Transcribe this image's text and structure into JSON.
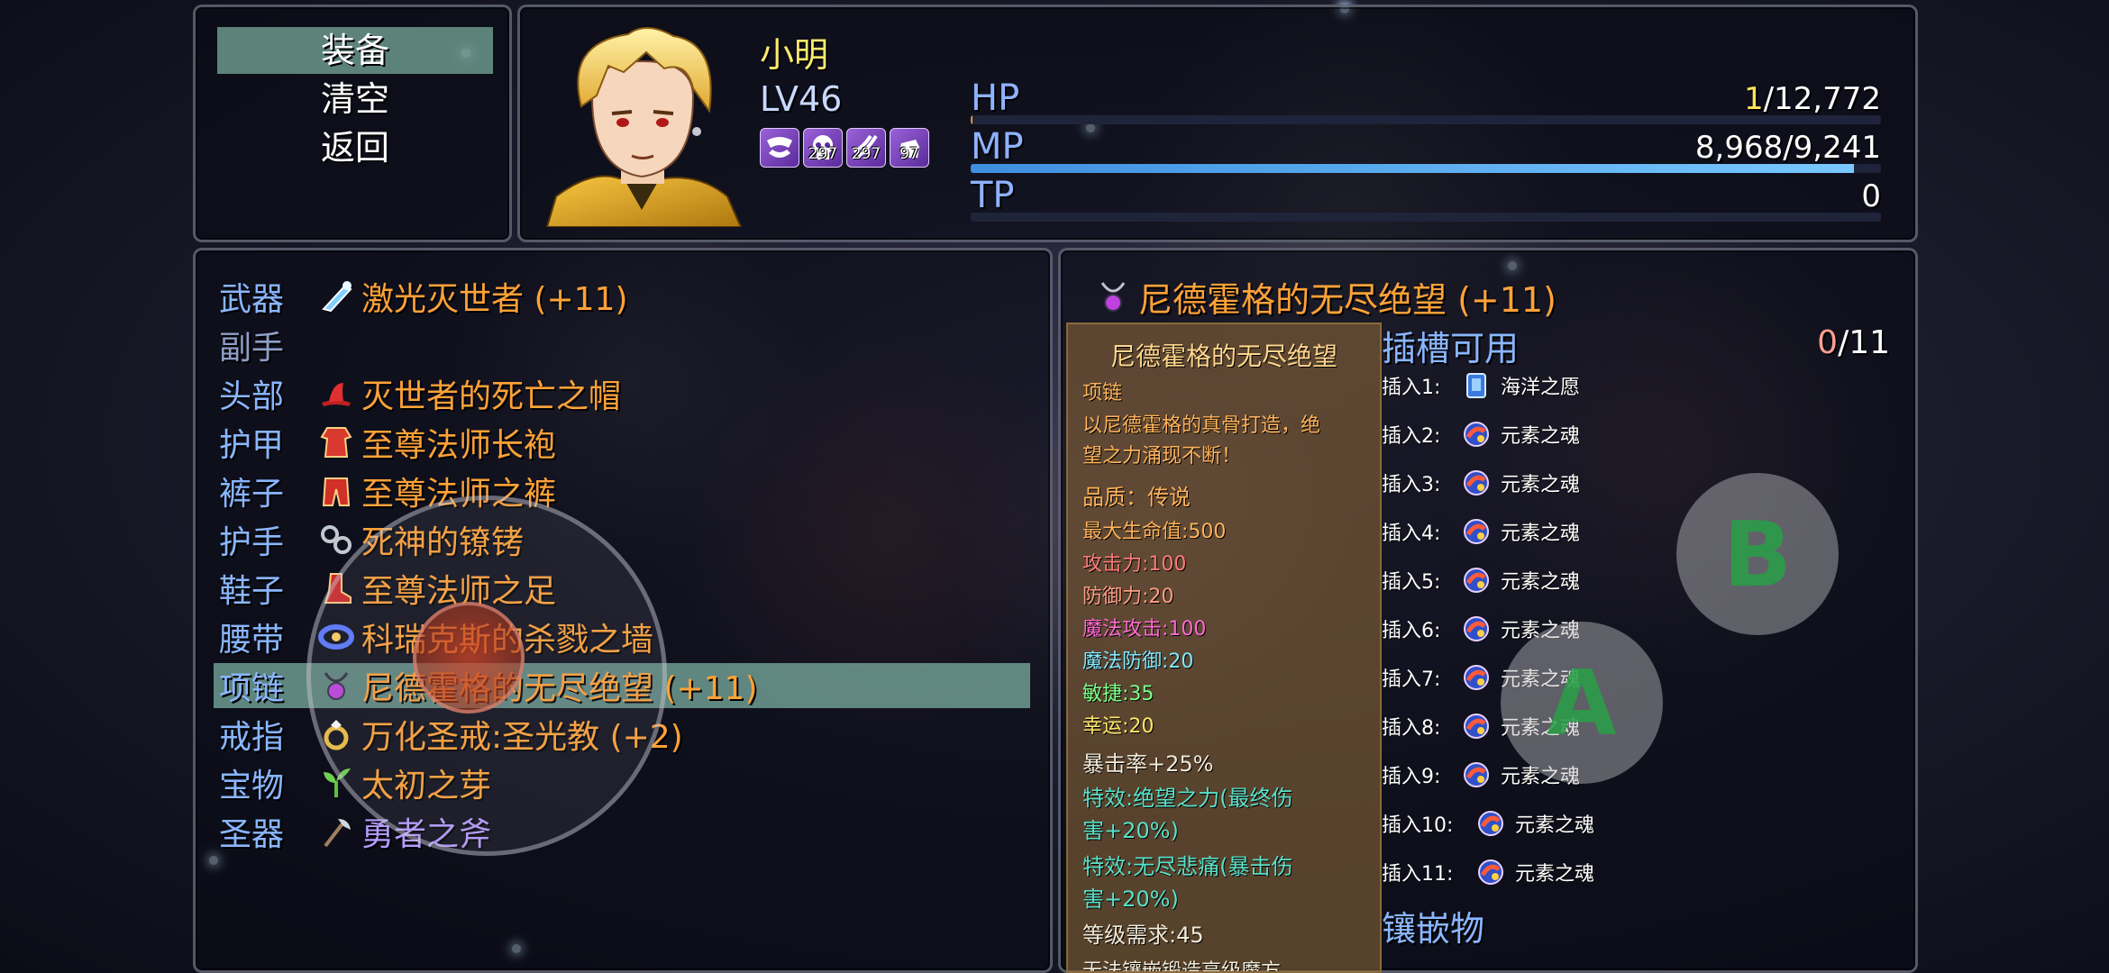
{
  "commands": {
    "equip": "装备",
    "clear": "清空",
    "back": "返回"
  },
  "actor": {
    "name": "小明",
    "level": "LV46",
    "states": [
      {
        "icon": "jaws-icon",
        "turns": ""
      },
      {
        "icon": "skull-icon",
        "turns": "297"
      },
      {
        "icon": "slash-icon",
        "turns": "297"
      },
      {
        "icon": "fist-icon",
        "turns": "97"
      }
    ],
    "hp": {
      "label": "HP",
      "current": "1",
      "max": "/12,772",
      "ratio": 0.0001
    },
    "mp": {
      "label": "MP",
      "value": "8,968/9,241",
      "ratio": 0.97
    },
    "tp": {
      "label": "TP",
      "value": "0",
      "ratio": 0
    }
  },
  "equip_slots": [
    {
      "slot": "武器",
      "item": "激光灭世者 (+11)",
      "icon": "laser-gun-icon"
    },
    {
      "slot": "副手",
      "item": "",
      "icon": ""
    },
    {
      "slot": "头部",
      "item": "灭世者的死亡之帽",
      "icon": "red-hat-icon"
    },
    {
      "slot": "护甲",
      "item": "至尊法师长袍",
      "icon": "robe-icon"
    },
    {
      "slot": "裤子",
      "item": "至尊法师之裤",
      "icon": "pants-icon"
    },
    {
      "slot": "护手",
      "item": "死神的镣铐",
      "icon": "shackles-icon"
    },
    {
      "slot": "鞋子",
      "item": "至尊法师之足",
      "icon": "boots-icon"
    },
    {
      "slot": "腰带",
      "item": "科瑞克斯的杀戮之墙",
      "icon": "belt-icon"
    },
    {
      "slot": "项链",
      "item": "尼德霍格的无尽绝望 (+11)",
      "icon": "necklace-icon"
    },
    {
      "slot": "戒指",
      "item": "万化圣戒:圣光教 (+2)",
      "icon": "ring-icon"
    },
    {
      "slot": "宝物",
      "item": "太初之芽",
      "icon": "sprout-icon"
    },
    {
      "slot": "圣器",
      "item": "勇者之斧",
      "icon": "axe-icon"
    }
  ],
  "detail": {
    "title": "尼德霍格的无尽绝望 (+11)",
    "desc_title": "尼德霍格的无尽绝望",
    "type": "项链",
    "flavor": [
      "以尼德霍格的真骨打造，绝",
      "望之力涌现不断！"
    ],
    "quality": "品质：传说",
    "stats": [
      {
        "text": "最大生命值:500",
        "color": "#ffb35a"
      },
      {
        "text": "攻击力:100",
        "color": "#ff7c7c"
      },
      {
        "text": "防御力:20",
        "color": "#ff9e86"
      },
      {
        "text": "魔法攻击:100",
        "color": "#ff6ad0"
      },
      {
        "text": "魔法防御:20",
        "color": "#82e8ff"
      },
      {
        "text": "敏捷:35",
        "color": "#7cff88"
      },
      {
        "text": "幸运:20",
        "color": "#ffe86a"
      }
    ],
    "crit": "暴击率+25%",
    "effects": [
      [
        "特效:绝望之力(最终伤",
        "害+20%)"
      ],
      [
        "特效:无尽悲痛(暴击伤",
        "害+20%)"
      ]
    ],
    "level_req": "等级需求:45",
    "cut_line": "无法镶嵌锻造高级魔方",
    "sockets_header": "插槽可用",
    "sockets_current": "0",
    "sockets_max": "/11",
    "sockets": [
      {
        "label": "插入1:",
        "item": "海洋之愿",
        "icon": "blue-gem-icon"
      },
      {
        "label": "插入2:",
        "item": "元素之魂",
        "icon": "element-soul-icon"
      },
      {
        "label": "插入3:",
        "item": "元素之魂",
        "icon": "element-soul-icon"
      },
      {
        "label": "插入4:",
        "item": "元素之魂",
        "icon": "element-soul-icon"
      },
      {
        "label": "插入5:",
        "item": "元素之魂",
        "icon": "element-soul-icon"
      },
      {
        "label": "插入6:",
        "item": "元素之魂",
        "icon": "element-soul-icon"
      },
      {
        "label": "插入7:",
        "item": "元素之魂",
        "icon": "element-soul-icon"
      },
      {
        "label": "插入8:",
        "item": "元素之魂",
        "icon": "element-soul-icon"
      },
      {
        "label": "插入9:",
        "item": "元素之魂",
        "icon": "element-soul-icon"
      },
      {
        "label": "插入10:",
        "item": "元素之魂",
        "icon": "element-soul-icon"
      },
      {
        "label": "插入11:",
        "item": "元素之魂",
        "icon": "element-soul-icon"
      }
    ],
    "embed_header": "镶嵌物"
  },
  "controls": {
    "b_label": "B",
    "a_label": "A"
  }
}
